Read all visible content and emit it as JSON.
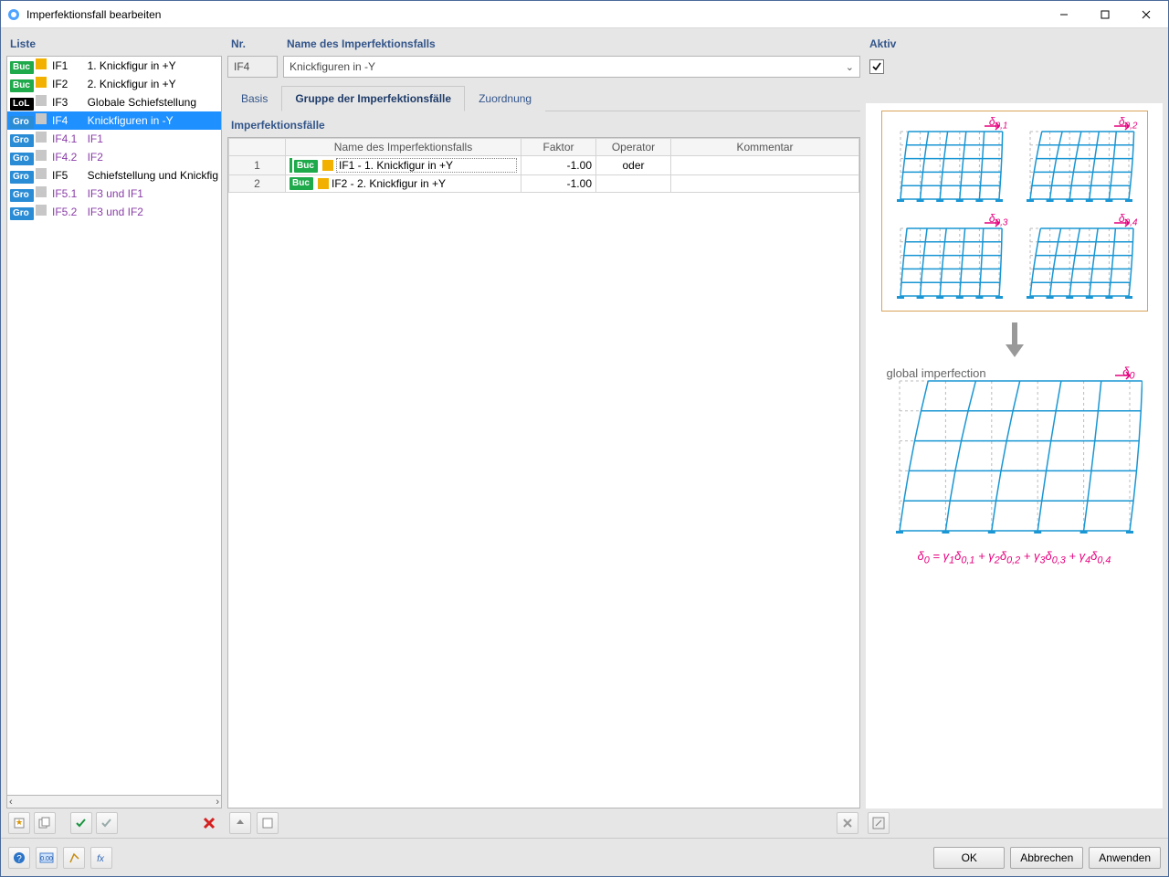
{
  "window": {
    "title": "Imperfektionsfall bearbeiten"
  },
  "left": {
    "heading": "Liste",
    "items": [
      {
        "tag": "Buc",
        "tagClass": "buc",
        "sw": "y",
        "id": "IF1",
        "name": "1. Knickfigur in +Y"
      },
      {
        "tag": "Buc",
        "tagClass": "buc",
        "sw": "y",
        "id": "IF2",
        "name": "2. Knickfigur in +Y"
      },
      {
        "tag": "LoL",
        "tagClass": "lol",
        "sw": "g",
        "id": "IF3",
        "name": "Globale Schiefstellung"
      },
      {
        "tag": "Gro",
        "tagClass": "gro",
        "sw": "g",
        "id": "IF4",
        "name": "Knickfiguren in -Y",
        "selected": true
      },
      {
        "tag": "Gro",
        "tagClass": "gro",
        "sw": "g",
        "id": "IF4.1",
        "name": "IF1",
        "sub": true
      },
      {
        "tag": "Gro",
        "tagClass": "gro",
        "sw": "g",
        "id": "IF4.2",
        "name": "IF2",
        "sub": true
      },
      {
        "tag": "Gro",
        "tagClass": "gro",
        "sw": "g",
        "id": "IF5",
        "name": "Schiefstellung und Knickfig"
      },
      {
        "tag": "Gro",
        "tagClass": "gro",
        "sw": "g",
        "id": "IF5.1",
        "name": "IF3 und IF1",
        "sub": true
      },
      {
        "tag": "Gro",
        "tagClass": "gro",
        "sw": "g",
        "id": "IF5.2",
        "name": "IF3 und IF2",
        "sub": true
      }
    ]
  },
  "nr": {
    "label": "Nr.",
    "value": "IF4"
  },
  "name": {
    "label": "Name des Imperfektionsfalls",
    "value": "Knickfiguren in -Y"
  },
  "aktiv": {
    "label": "Aktiv",
    "checked": true
  },
  "tabs": {
    "items": [
      "Basis",
      "Gruppe der Imperfektionsfälle",
      "Zuordnung"
    ],
    "active": 1
  },
  "table": {
    "heading": "Imperfektionsfälle",
    "headers": {
      "name": "Name des Imperfektionsfalls",
      "faktor": "Faktor",
      "operator": "Operator",
      "kommentar": "Kommentar"
    },
    "rows": [
      {
        "n": "1",
        "tag": "Buc",
        "id": "IF1",
        "desc": "1. Knickfigur in +Y",
        "faktor": "-1.00",
        "operator": "oder",
        "kommentar": ""
      },
      {
        "n": "2",
        "tag": "Buc",
        "id": "IF2",
        "desc": "2. Knickfigur in +Y",
        "faktor": "-1.00",
        "operator": "",
        "kommentar": ""
      }
    ]
  },
  "diagram": {
    "d": [
      "δ",
      "0,1",
      "0,2",
      "0,3",
      "0,4"
    ],
    "global_label": "global imperfection",
    "d0": "δ₀",
    "formula": "δ₀ = γ₁δ₀,₁ + γ₂δ₀,₂ + γ₃δ₀,₃ + γ₄δ₀,₄"
  },
  "buttons": {
    "ok": "OK",
    "cancel": "Abbrechen",
    "apply": "Anwenden"
  }
}
